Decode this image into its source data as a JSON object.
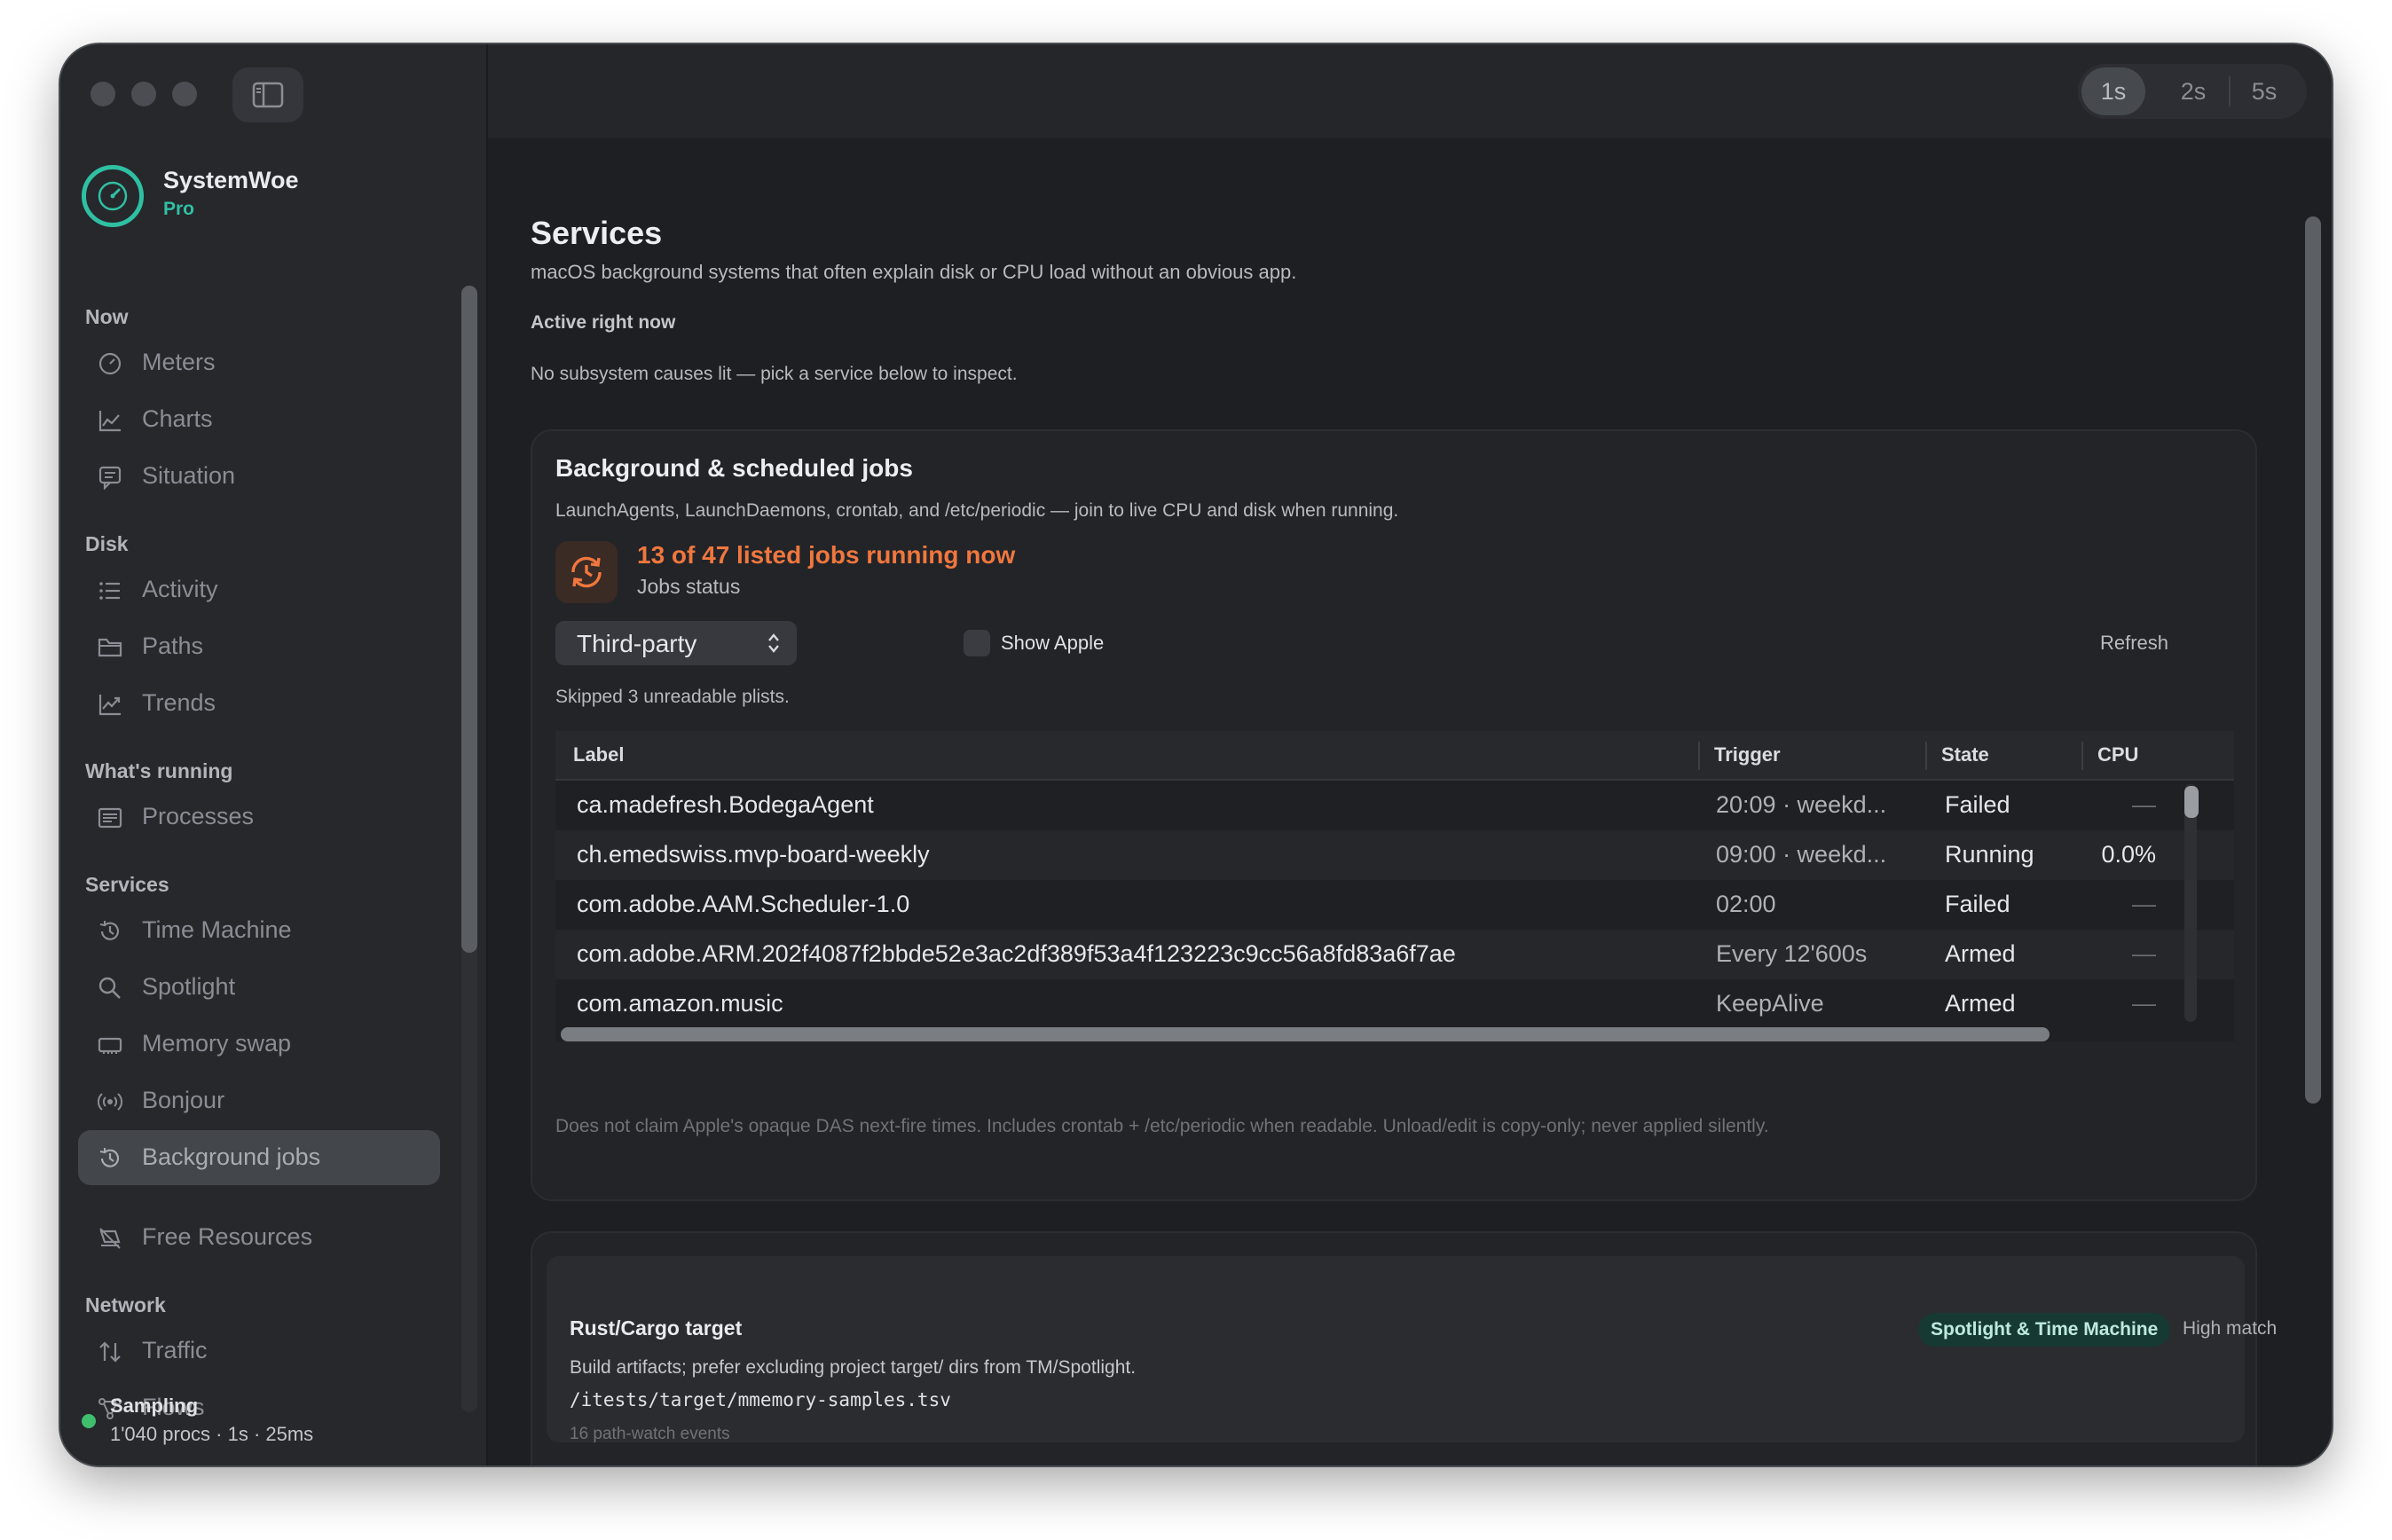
{
  "window": {
    "interval_options": [
      "1s",
      "2s",
      "5s"
    ],
    "interval_selected": "1s"
  },
  "brand": {
    "name": "SystemWoe",
    "tier": "Pro"
  },
  "sidebar": {
    "sections": [
      {
        "title": "Now",
        "items": [
          {
            "label": "Meters",
            "icon": "gauge-icon"
          },
          {
            "label": "Charts",
            "icon": "line-chart-icon"
          },
          {
            "label": "Situation",
            "icon": "message-icon"
          }
        ]
      },
      {
        "title": "Disk",
        "items": [
          {
            "label": "Activity",
            "icon": "list-icon"
          },
          {
            "label": "Paths",
            "icon": "folder-icon"
          },
          {
            "label": "Trends",
            "icon": "trend-icon"
          }
        ]
      },
      {
        "title": "What's running",
        "items": [
          {
            "label": "Processes",
            "icon": "processes-icon"
          }
        ]
      },
      {
        "title": "Services",
        "items": [
          {
            "label": "Time Machine",
            "icon": "clock-history-icon"
          },
          {
            "label": "Spotlight",
            "icon": "magnifier-icon"
          },
          {
            "label": "Memory swap",
            "icon": "memory-icon"
          },
          {
            "label": "Bonjour",
            "icon": "broadcast-icon"
          },
          {
            "label": "Background jobs",
            "icon": "background-jobs-icon",
            "active": true
          },
          {
            "label": "Free Resources",
            "icon": "free-resources-icon"
          }
        ]
      },
      {
        "title": "Network",
        "items": [
          {
            "label": "Traffic",
            "icon": "arrows-updown-icon"
          },
          {
            "label": "Flows",
            "icon": "flows-icon"
          }
        ]
      }
    ],
    "status": {
      "title": "Sampling",
      "detail": "1'040 procs · 1s · 25ms",
      "color": "#3fbf6e"
    }
  },
  "page": {
    "title": "Services",
    "subtitle": "macOS background systems that often explain disk or CPU load without an obvious app.",
    "active_header": "Active right now",
    "active_message": "No subsystem causes lit — pick a service below to inspect."
  },
  "jobs": {
    "title": "Background & scheduled jobs",
    "subtitle": "LaunchAgents, LaunchDaemons, crontab, and /etc/periodic — join to live CPU and disk when running.",
    "headline": "13 of 47 listed jobs running now",
    "headline_color": "#f0773e",
    "status_label": "Jobs status",
    "filter_value": "Third-party",
    "show_apple_label": "Show Apple",
    "refresh_label": "Refresh",
    "skipped_note": "Skipped 3 unreadable plists.",
    "columns": [
      "Label",
      "Trigger",
      "State",
      "CPU"
    ],
    "rows": [
      {
        "label": "ca.madefresh.BodegaAgent",
        "trigger": "20:09 · weekd...",
        "state": "Failed",
        "cpu": "—"
      },
      {
        "label": "ch.emedswiss.mvp-board-weekly",
        "trigger": "09:00 · weekd...",
        "state": "Running",
        "cpu": "0.0%"
      },
      {
        "label": "com.adobe.AAM.Scheduler-1.0",
        "trigger": "02:00",
        "state": "Failed",
        "cpu": "—"
      },
      {
        "label": "com.adobe.ARM.202f4087f2bbde52e3ac2df389f53a4f123223c9cc56a8fd83a6f7ae",
        "trigger": "Every 12'600s",
        "state": "Armed",
        "cpu": "—"
      },
      {
        "label": "com.amazon.music",
        "trigger": "KeepAlive",
        "state": "Armed",
        "cpu": "—"
      }
    ],
    "footnote": "Does not claim Apple's opaque DAS next-fire times. Includes crontab + /etc/periodic when readable. Unload/edit is copy-only; never applied silently."
  },
  "recommendation": {
    "title": "Rust/Cargo target",
    "badge": "Spotlight & Time Machine",
    "match": "High match",
    "description": "Build artifacts; prefer excluding project target/ dirs from TM/Spotlight.",
    "path": "/itests/target/mmemory-samples.tsv",
    "events": "16 path-watch events"
  }
}
